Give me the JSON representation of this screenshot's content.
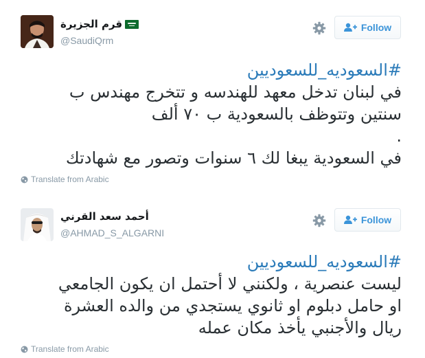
{
  "tweets": [
    {
      "author": {
        "display_name": "قرم الجزيرة",
        "handle": "@SaudiQrm",
        "flag_icon": "saudi-flag-icon"
      },
      "follow_label": "Follow",
      "hashtag": "#السعوديه_للسعوديين",
      "lines": [
        "في لبنان تدخل معهد للهندسه و تتخرج مهندس ب",
        "سنتين وتتوظف بالسعودية ب ٧٠ ألف",
        ".",
        "في السعودية يبغا لك ٦ سنوات وتصور مع شهادتك"
      ],
      "translate_label": "Translate from Arabic"
    },
    {
      "author": {
        "display_name": "أحمد سعد القرني",
        "handle": "@AHMAD_S_ALGARNI"
      },
      "follow_label": "Follow",
      "hashtag": "#السعوديه_للسعوديين",
      "lines": [
        "ليست عنصرية ، ولكنني لا أحتمل ان يكون الجامعي",
        "او حامل دبلوم او ثانوي يستجدي من والده العشرة",
        "ريال والأجنبي يأخذ مكان عمله"
      ],
      "translate_label": "Translate from Arabic"
    }
  ],
  "colors": {
    "link": "#2b7bb9",
    "follow_text": "#3b94d9",
    "muted": "#8899a6",
    "text": "#292f33"
  }
}
